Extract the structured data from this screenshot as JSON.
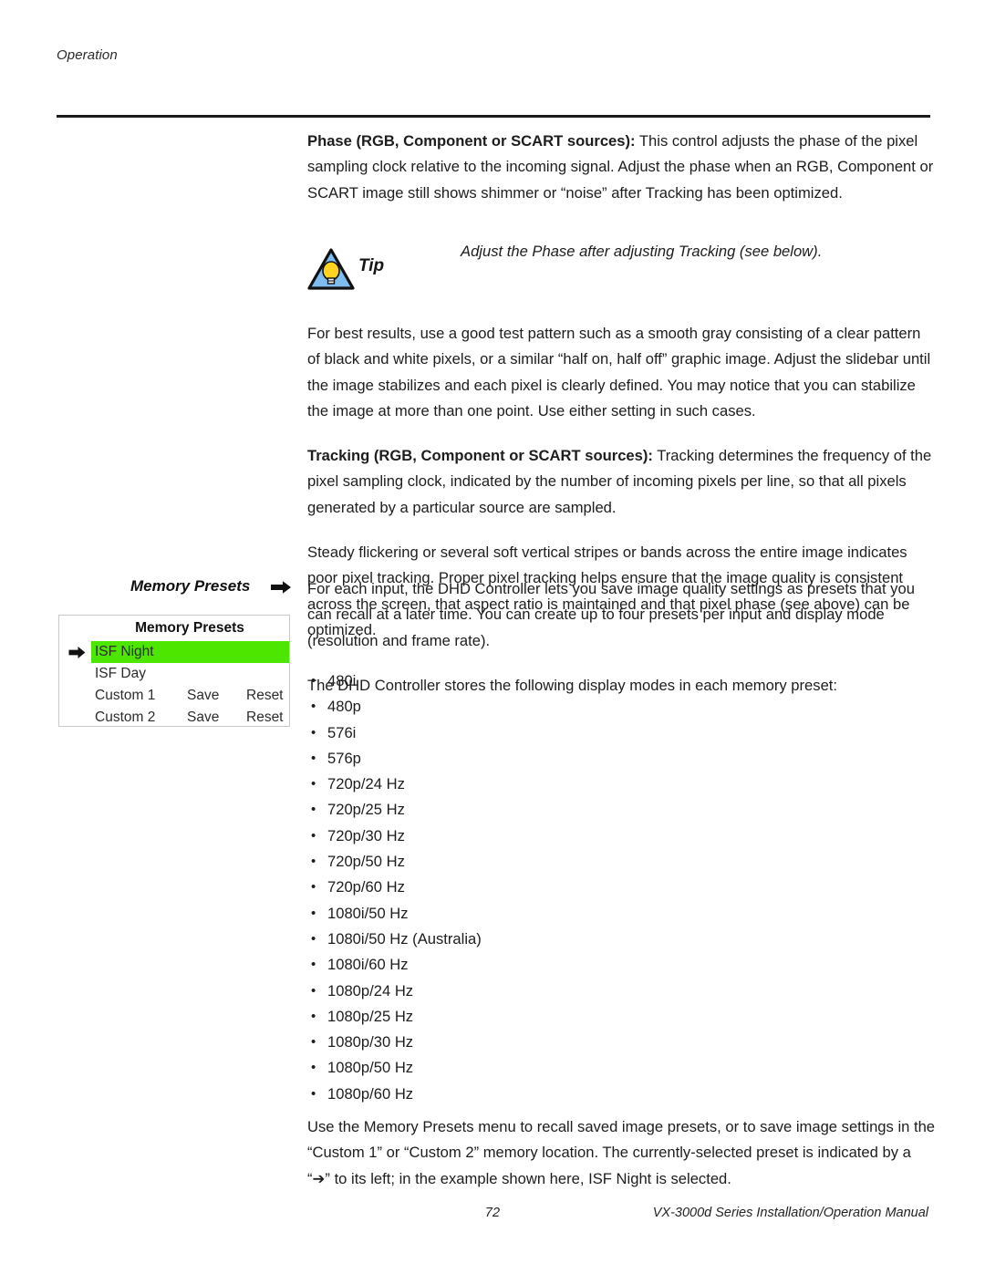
{
  "page": {
    "running_head": "Operation",
    "footer_page_number": "72",
    "footer_manual_title": "VX-3000d Series Installation/Operation Manual"
  },
  "colors": {
    "highlight_green": "#4ce600",
    "tip_triangle_fill": "#7fbdf0",
    "tip_bulb_fill": "#ffd320",
    "rule": "#1a1a1a",
    "menu_border": "#c9c9c9"
  },
  "sections": {
    "phase": {
      "lead_in": "Phase (RGB, Component or SCART sources):",
      "body": " This control adjusts the phase of the pixel sampling clock relative to the incoming signal. Adjust the phase when an RGB, Component or SCART image still shows shimmer or “noise” after Tracking has been optimized."
    },
    "tip": {
      "label": "Tip",
      "icon": "tip-lightbulb-icon",
      "text": "Adjust the Phase after adjusting Tracking (see below)."
    },
    "best_results": "For best results, use a good test pattern such as a smooth gray consisting of a clear pattern of black and white pixels, or a similar “half on, half off” graphic image. Adjust the slidebar until the image stabilizes and each pixel is clearly defined. You may notice that you can stabilize the image at more than one point. Use either setting in such cases.",
    "tracking": {
      "lead_in": "Tracking (RGB, Component or SCART sources):",
      "body": " Tracking determines the frequency of the pixel sampling clock, indicated by the number of incoming pixels per line, so that all pixels generated by a particular source are sampled."
    },
    "flickering": "Steady flickering or several soft vertical stripes or bands across the entire image indicates poor pixel tracking. Proper pixel tracking helps ensure that the image quality is consistent across the screen, that aspect ratio is maintained and that pixel phase (see above) can be optimized.",
    "memory_presets_side_heading": "Memory Presets",
    "each_input": "For each input, the DHD Controller lets you save image quality settings as presets that you can recall at a later time. You can create up to four presets per input and display mode (resolution and frame rate).",
    "stores_modes_intro": "The DHD Controller stores the following display modes in each memory preset:",
    "display_modes": [
      "480i",
      "480p",
      "576i",
      "576p",
      "720p/24 Hz",
      "720p/25 Hz",
      "720p/30 Hz",
      "720p/50 Hz",
      "720p/60 Hz",
      "1080i/50 Hz",
      "1080i/50 Hz (Australia)",
      "1080i/60 Hz",
      "1080p/24 Hz",
      "1080p/25 Hz",
      "1080p/30 Hz",
      "1080p/50 Hz",
      "1080p/60 Hz"
    ],
    "closing": "Use the Memory Presets menu to recall saved image presets, or to save image settings in the “Custom 1” or “Custom 2” memory location. The currently-selected preset is indicated by a “➔” to its left; in the example shown here, ISF Night is selected."
  },
  "memory_presets_menu": {
    "title": "Memory Presets",
    "rows": [
      {
        "label": "ISF Night",
        "selected": true,
        "save": "",
        "reset": ""
      },
      {
        "label": "ISF Day",
        "selected": false,
        "save": "",
        "reset": ""
      },
      {
        "label": "Custom 1",
        "selected": false,
        "save": "Save",
        "reset": "Reset"
      },
      {
        "label": "Custom 2",
        "selected": false,
        "save": "Save",
        "reset": "Reset"
      }
    ]
  }
}
